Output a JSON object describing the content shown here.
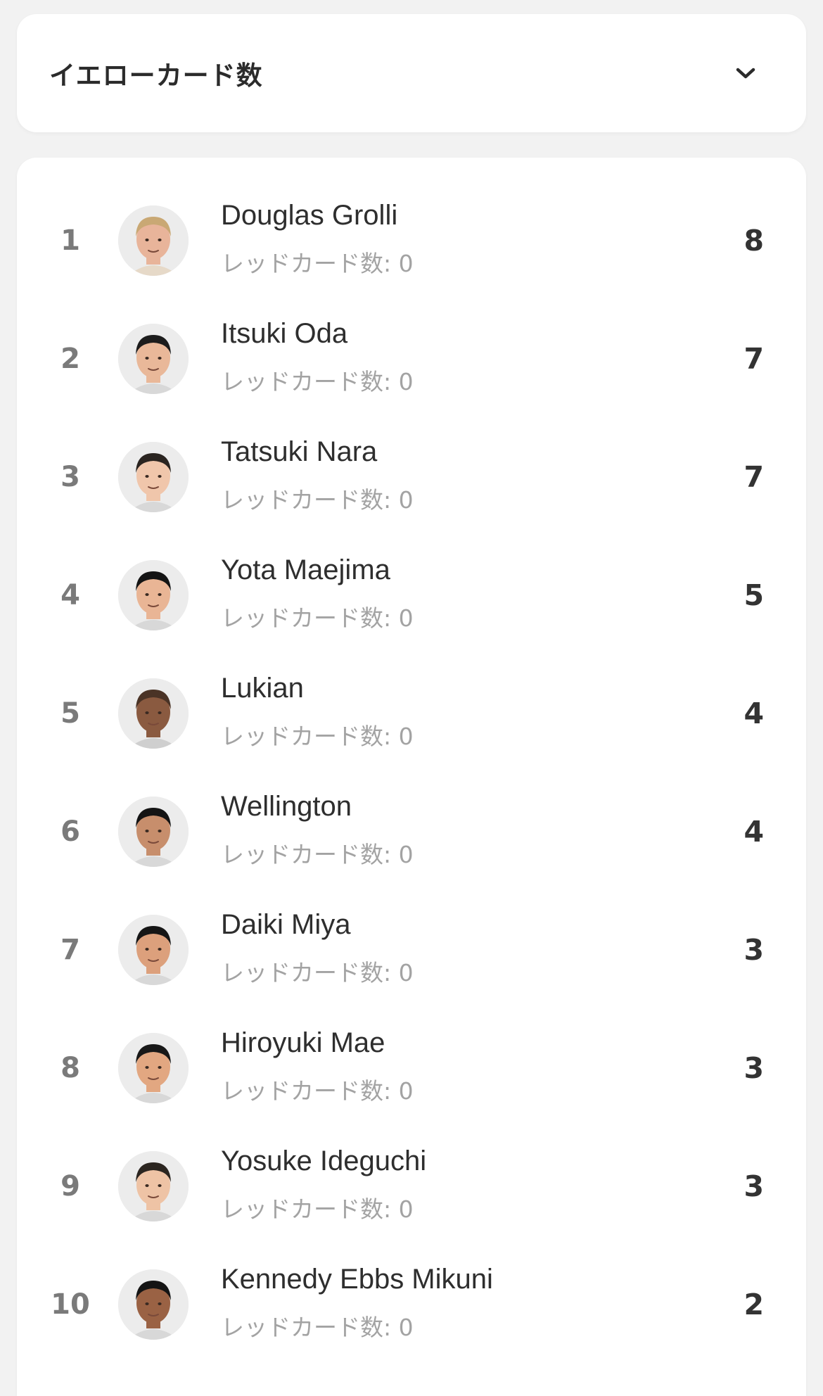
{
  "dropdown": {
    "label": "イエローカード数",
    "icon": "chevron-down-icon"
  },
  "players": [
    {
      "rank": "1",
      "name": "Douglas Grolli",
      "sub_label": "レッドカード数:",
      "red_cards": "0",
      "yellow_cards": "8",
      "avatar": {
        "skin": "#e8b49a",
        "hair": "#c9a874",
        "shirt": "#e6d9c8"
      }
    },
    {
      "rank": "2",
      "name": "Itsuki Oda",
      "sub_label": "レッドカード数:",
      "red_cards": "0",
      "yellow_cards": "7",
      "avatar": {
        "skin": "#e9b899",
        "hair": "#1c1c1c",
        "shirt": "#d8d8d8"
      }
    },
    {
      "rank": "3",
      "name": "Tatsuki Nara",
      "sub_label": "レッドカード数:",
      "red_cards": "0",
      "yellow_cards": "7",
      "avatar": {
        "skin": "#f0c6ab",
        "hair": "#2a2420",
        "shirt": "#d8d8d8"
      }
    },
    {
      "rank": "4",
      "name": "Yota Maejima",
      "sub_label": "レッドカード数:",
      "red_cards": "0",
      "yellow_cards": "5",
      "avatar": {
        "skin": "#e9b595",
        "hair": "#141414",
        "shirt": "#d8d8d8"
      }
    },
    {
      "rank": "5",
      "name": "Lukian",
      "sub_label": "レッドカード数:",
      "red_cards": "0",
      "yellow_cards": "4",
      "avatar": {
        "skin": "#8a5a40",
        "hair": "#4a3326",
        "shirt": "#cfcfcf"
      }
    },
    {
      "rank": "6",
      "name": "Wellington",
      "sub_label": "レッドカード数:",
      "red_cards": "0",
      "yellow_cards": "4",
      "avatar": {
        "skin": "#c78e6c",
        "hair": "#141414",
        "shirt": "#d8d8d8"
      }
    },
    {
      "rank": "7",
      "name": "Daiki Miya",
      "sub_label": "レッドカード数:",
      "red_cards": "0",
      "yellow_cards": "3",
      "avatar": {
        "skin": "#dca07c",
        "hair": "#161616",
        "shirt": "#d8d8d8"
      }
    },
    {
      "rank": "8",
      "name": "Hiroyuki Mae",
      "sub_label": "レッドカード数:",
      "red_cards": "0",
      "yellow_cards": "3",
      "avatar": {
        "skin": "#e2a781",
        "hair": "#181818",
        "shirt": "#d8d8d8"
      }
    },
    {
      "rank": "9",
      "name": "Yosuke Ideguchi",
      "sub_label": "レッドカード数:",
      "red_cards": "0",
      "yellow_cards": "3",
      "avatar": {
        "skin": "#eec3a5",
        "hair": "#2b2520",
        "shirt": "#d8d8d8"
      }
    },
    {
      "rank": "10",
      "name": "Kennedy Ebbs Mikuni",
      "sub_label": "レッドカード数:",
      "red_cards": "0",
      "yellow_cards": "2",
      "avatar": {
        "skin": "#9a6244",
        "hair": "#141414",
        "shirt": "#d8d8d8"
      }
    }
  ]
}
